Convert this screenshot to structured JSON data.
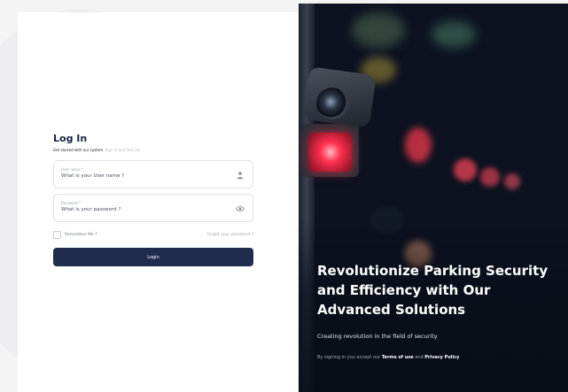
{
  "login": {
    "title": "Log In",
    "subtitle_prefix": "Get started with our system.",
    "subtitle_muted": "Sign in and find out.",
    "username": {
      "label": "User name *",
      "placeholder": "What is your User name ?",
      "icon": "user-icon"
    },
    "password": {
      "label": "Password *",
      "placeholder": "What is your password ?",
      "icon": "eye-icon"
    },
    "remember_label": "Remember Me ?",
    "forgot_label": "Forgot your password ?",
    "login_button": "Login"
  },
  "hero": {
    "headline": "Revolutionize Parking Security and Efficiency with Our Advanced  Solutions",
    "tagline": "Creating revolution in the field of security",
    "legal_prefix": "By signing in you accept our",
    "terms_link": "Terms of use",
    "legal_and": "and",
    "privacy_link": "Privacy Policy"
  },
  "colors": {
    "primary": "#1f2c4d",
    "camera_light": "#ff3050"
  }
}
